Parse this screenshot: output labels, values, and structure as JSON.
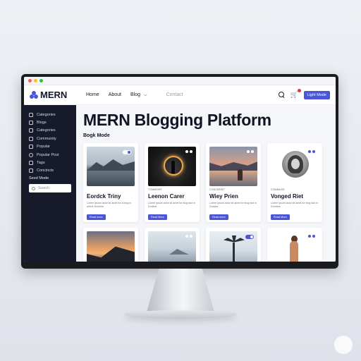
{
  "navbar": {
    "logo_text": "MERN",
    "links": [
      "Home",
      "About",
      "Blog",
      "Contact"
    ],
    "mode_button": "Light Mode"
  },
  "sidebar": {
    "items": [
      "Categories",
      "Blogs",
      "Categories",
      "Community",
      "Popular",
      "Popular Post",
      "Tags",
      "Concincts"
    ],
    "section_title": "Seed Mode",
    "search_placeholder": "Search"
  },
  "main": {
    "title": "MERN Blogging Platform",
    "section_label": "Bogk Mode"
  },
  "cards": [
    {
      "tag": "",
      "title": "Eordck Triny",
      "text": "Lorem ipsum dolor sit amet for a blog in article Dolorine",
      "button": "Read more"
    },
    {
      "tag": "TOMMSIRT",
      "title": "Leenon Carer",
      "text": "Lorem ipsum dolor sit amet for blog fact in Dorlinet",
      "button": "Read More"
    },
    {
      "tag": "CONTARIST",
      "title": "Wiey Prien",
      "text": "Lorem ipsum dolor sit amet for blog fact in Doripes",
      "button": "Read more"
    },
    {
      "tag": "COMMUSS",
      "title": "Vonged Riet",
      "text": "Lorem ipsum dolor sit amet for blog fact in Dorotres",
      "button": "Read More"
    }
  ],
  "colors": {
    "accent": "#4b55d6",
    "sidebar": "#161a2b",
    "dot_red": "#ff5f57",
    "dot_yellow": "#febc2e",
    "dot_green": "#28c840"
  }
}
